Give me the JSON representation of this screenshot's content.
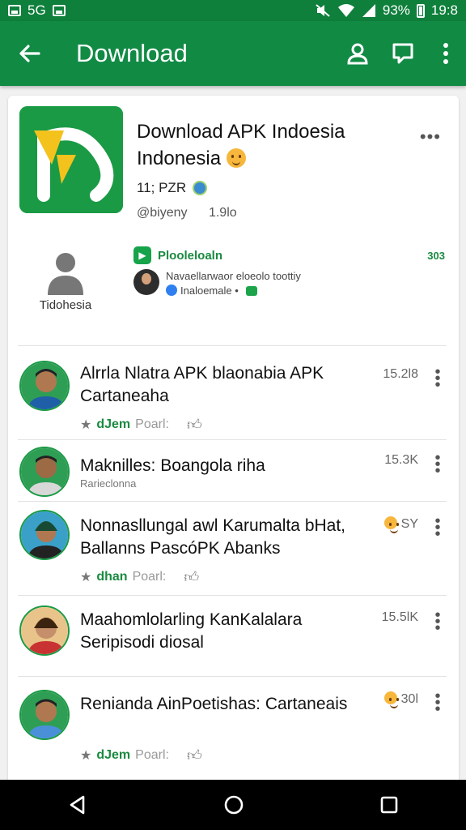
{
  "status_bar": {
    "network": "5G",
    "battery": "93%",
    "time": "19:8"
  },
  "app_bar": {
    "title": "Download"
  },
  "header": {
    "app_title_line1": "Download APK Indoesia",
    "app_title_line2": "Indonesia",
    "rating": "11; PZR",
    "handle": "@biyeny",
    "version": "1.9lo"
  },
  "promo": {
    "avatar_label": "Tidohesia",
    "title": "Plooleloaln",
    "percent": "303",
    "line1": "Navaellarwaor eloeolo toottiy",
    "line2": "Inaloemale"
  },
  "items": [
    {
      "title": "Alrrla Nlatra APK blaonabia APK Cartaneaha",
      "count": "15.2l8",
      "meta_green": "dJem",
      "meta_text": "Poarl:",
      "sub": ""
    },
    {
      "title": "Maknilles: Boangola riha",
      "count": "15.3K",
      "meta_green": "",
      "meta_text": "",
      "sub": "Rarieclonna"
    },
    {
      "title": "Nonnasllungal awl Karumalta bHat, Ballanns PascóPK Abanks",
      "count": "SY",
      "meta_green": "dhan",
      "meta_text": "Poarl:",
      "sub": ""
    },
    {
      "title": "Maahomlolarling KanKalalara Seripisodi diosal",
      "count": "15.5lK",
      "meta_green": "",
      "meta_text": "",
      "sub": ""
    },
    {
      "title": "Renianda AinPoetishas: Cartaneais",
      "count": "30l",
      "meta_green": "dJem",
      "meta_text": "Poarl:",
      "sub": ""
    }
  ],
  "colors": {
    "primary": "#118a44",
    "status": "#0f7f3c",
    "accent_green": "#1a8a40"
  }
}
